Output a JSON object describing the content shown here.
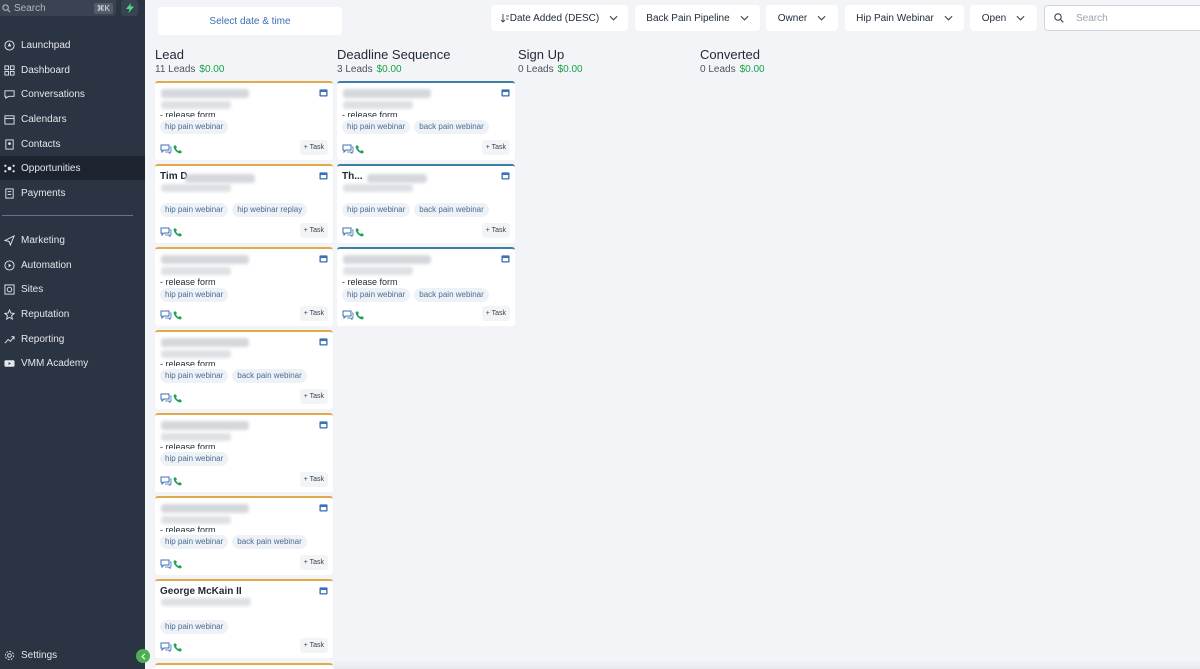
{
  "sidebar": {
    "search_label": "Search",
    "search_shortcut": "⌘K",
    "items": [
      {
        "label": "Launchpad",
        "icon": "rocket-icon"
      },
      {
        "label": "Dashboard",
        "icon": "grid-icon"
      },
      {
        "label": "Conversations",
        "icon": "chat-icon"
      },
      {
        "label": "Calendars",
        "icon": "calendar-icon"
      },
      {
        "label": "Contacts",
        "icon": "contacts-icon"
      },
      {
        "label": "Opportunities",
        "icon": "opportunities-icon"
      },
      {
        "label": "Payments",
        "icon": "payments-icon"
      },
      {
        "label": "Marketing",
        "icon": "send-icon"
      },
      {
        "label": "Automation",
        "icon": "automation-icon"
      },
      {
        "label": "Sites",
        "icon": "sites-icon"
      },
      {
        "label": "Reputation",
        "icon": "star-icon"
      },
      {
        "label": "Reporting",
        "icon": "trend-icon"
      },
      {
        "label": "VMM Academy",
        "icon": "video-icon"
      }
    ],
    "settings_label": "Settings"
  },
  "toolbar": {
    "date_button": "Select date & time",
    "sort": "Date Added (DESC)",
    "pipeline": "Back Pain Pipeline",
    "owner": "Owner",
    "campaign": "Hip Pain Webinar",
    "status": "Open",
    "search_placeholder": "Search"
  },
  "columns": [
    {
      "title": "Lead",
      "count": "11 Leads",
      "amount": "$0.00"
    },
    {
      "title": "Deadline Sequence",
      "count": "3 Leads",
      "amount": "$0.00"
    },
    {
      "title": "Sign Up",
      "count": "0 Leads",
      "amount": "$0.00"
    },
    {
      "title": "Converted",
      "count": "0 Leads",
      "amount": "$0.00"
    }
  ],
  "cards": {
    "task_label": "+ Task",
    "lead": [
      {
        "line": "- release form",
        "tags": [
          "hip pain webinar"
        ]
      },
      {
        "line": "Tim D...",
        "tags": [
          "hip pain webinar",
          "hip webinar replay"
        ]
      },
      {
        "line": "- release form",
        "tags": [
          "hip pain webinar"
        ]
      },
      {
        "line": "- release form",
        "tags": [
          "hip pain webinar",
          "back pain webinar"
        ]
      },
      {
        "line": "- release form",
        "tags": [
          "hip pain webinar"
        ]
      },
      {
        "line": "- release form",
        "tags": [
          "hip pain webinar",
          "back pain webinar"
        ]
      },
      {
        "line": "George McKain II",
        "tags": [
          "hip pain webinar"
        ]
      }
    ],
    "deadline": [
      {
        "line": "- release form",
        "tags": [
          "hip pain webinar",
          "back pain webinar"
        ]
      },
      {
        "line": "Th...",
        "tags": [
          "hip pain webinar",
          "back pain webinar"
        ]
      },
      {
        "line": "- release form",
        "tags": [
          "hip pain webinar",
          "back pain webinar"
        ]
      }
    ]
  },
  "colors": {
    "sidebar_bg": "#2b3443",
    "lead_accent": "#e0a94b",
    "deadline_accent": "#3d7ea6",
    "amount_green": "#16a34a",
    "tag_text": "#4a6c92"
  }
}
